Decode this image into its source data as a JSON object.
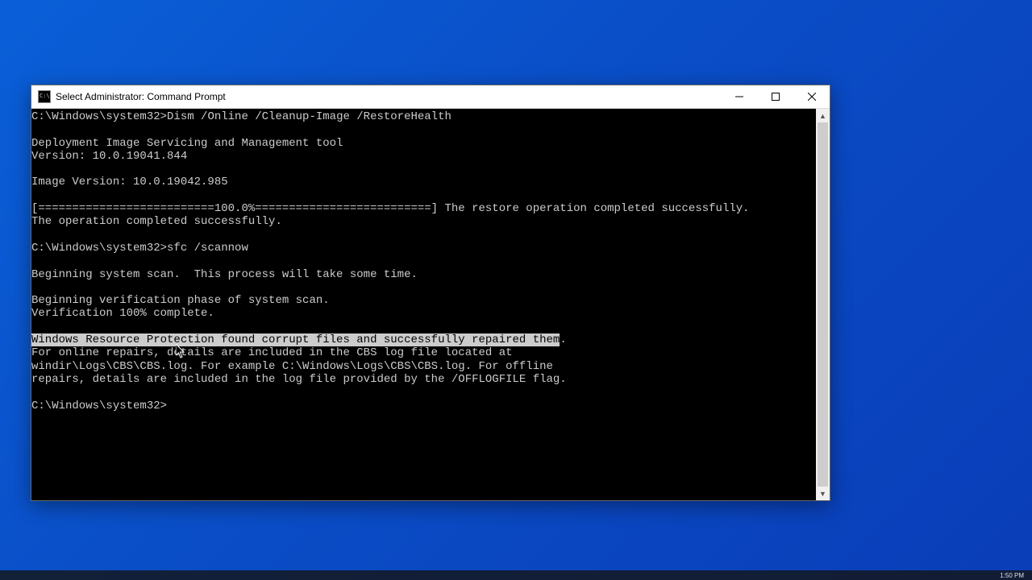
{
  "window": {
    "title": "Select Administrator: Command Prompt",
    "system_menu_glyph": "C:\\"
  },
  "terminal": {
    "prompt": "C:\\Windows\\system32>",
    "cmd_dism": "Dism /Online /Cleanup-Image /RestoreHealth",
    "dism_tool_line": "Deployment Image Servicing and Management tool",
    "dism_version_line": "Version: 10.0.19041.844",
    "dism_image_version_line": "Image Version: 10.0.19042.985",
    "dism_progress_line": "[==========================100.0%==========================] The restore operation completed successfully.",
    "dism_success_line": "The operation completed successfully.",
    "cmd_sfc": "sfc /scannow",
    "sfc_begin_line": "Beginning system scan.  This process will take some time.",
    "sfc_phase_line": "Beginning verification phase of system scan.",
    "sfc_verify_line": "Verification 100% complete.",
    "sfc_result_highlight": "Windows Resource Protection found corrupt files and successfully repaired them",
    "sfc_result_tail": ".",
    "sfc_log1": "For online repairs, details are included in the CBS log file located at",
    "sfc_log2": "windir\\Logs\\CBS\\CBS.log. For example C:\\Windows\\Logs\\CBS\\CBS.log. For offline",
    "sfc_log3": "repairs, details are included in the log file provided by the /OFFLOGFILE flag."
  },
  "taskbar": {
    "clock": "1:50 PM"
  }
}
